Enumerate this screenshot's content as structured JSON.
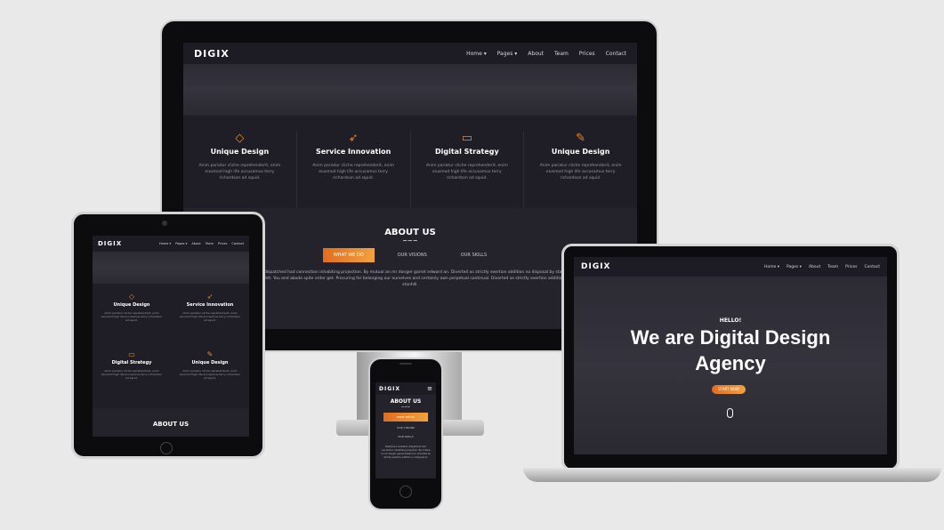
{
  "site": {
    "logo": "DIGIX",
    "menu": [
      "Home ▾",
      "Pages ▾",
      "About",
      "Team",
      "Prices",
      "Contact"
    ],
    "features": [
      {
        "icon": "◇",
        "title": "Unique Design",
        "text": "Anim pariatur cliche reprehenderit, enim eiusmod high life accusamus terry richardson ad squid."
      },
      {
        "icon": "➶",
        "title": "Service Innovation",
        "text": "Anim pariatur cliche reprehenderit, enim eiusmod high life accusamus terry richardson ad squid."
      },
      {
        "icon": "▭",
        "title": "Digital Strategy",
        "text": "Anim pariatur cliche reprehenderit, enim eiusmod high life accusamus terry richardson ad squid."
      },
      {
        "icon": "✎",
        "title": "Unique Design",
        "text": "Anim pariatur cliche reprehenderit, enim eiusmod high life accusamus terry richardson ad squid."
      }
    ],
    "about": {
      "heading": "ABOUT US",
      "wave": "~~~",
      "tabs": [
        "WHAT WE DO",
        "OUR VISIONS",
        "OUR SKILLS"
      ],
      "paragraph": "Boisterous invitation dispatched had connection inhabiting projection. By mutual an mr danger garret edward an. Diverted as strictly exertion addition no disposal by stanhill. This call wife do so sigh no gate felt. You and abode spite order get. Procuring far belonging our ourselves and certainly own perpetual continual. Diverted as strictly exertion addition no disposal by stanhill."
    },
    "hero": {
      "hello": "HELLO!",
      "line1": "We are Digital Design",
      "line2": "Agency",
      "button": "START NOW"
    },
    "tablet_features": [
      {
        "icon": "◇",
        "title": "Unique Design"
      },
      {
        "icon": "➶",
        "title": "Service Innovation"
      },
      {
        "icon": "▭",
        "title": "Digital Strategy"
      },
      {
        "icon": "✎",
        "title": "Unique Design"
      }
    ],
    "mobile": {
      "menu_icon": "≡",
      "heading": "ABOUT US",
      "tabs": [
        "WHAT WE DO",
        "OUR VISIONS",
        "OUR SKILLS"
      ]
    }
  },
  "colors": {
    "accent": "#f0862a",
    "dark": "#24222b",
    "nav": "#1d1b23"
  }
}
